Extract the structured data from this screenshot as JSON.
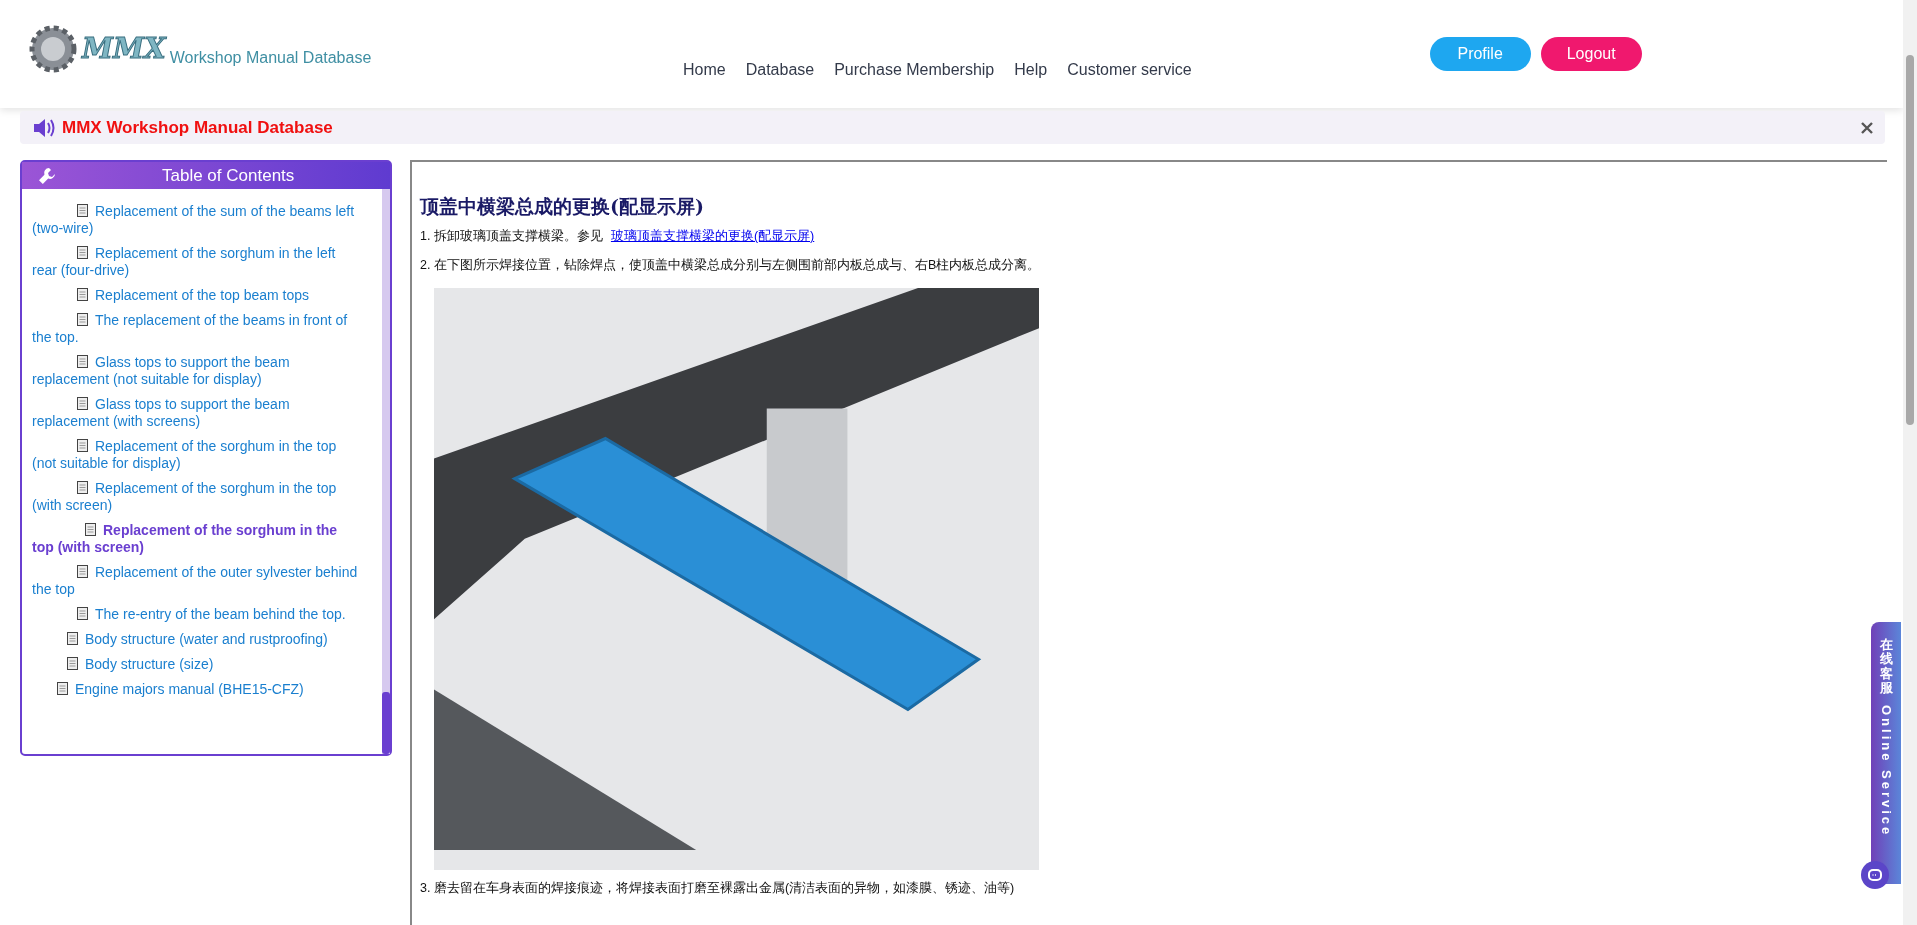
{
  "logo": {
    "mark": "MMX",
    "name": "Workshop Manual Database"
  },
  "nav": [
    "Home",
    "Database",
    "Purchase Membership",
    "Help",
    "Customer service"
  ],
  "account_buttons": [
    {
      "label": "Profile",
      "kind": "primary"
    },
    {
      "label": "Logout",
      "kind": "danger"
    }
  ],
  "notice": {
    "text": "MMX Workshop Manual Database"
  },
  "toc": {
    "title": "Table of Contents",
    "items": [
      {
        "children": [
          {
            "children": [
              {
                "label": "Replacement of the sum of the beams left (two-wire)",
                "selected": false
              },
              {
                "label": "Replacement of the sorghum in the left rear (four-drive)",
                "selected": false
              },
              {
                "label": "Replacement of the top beam tops",
                "selected": false
              },
              {
                "label": "The replacement of the beams in front of the top.",
                "selected": false
              },
              {
                "label": "Glass tops to support the beam replacement (not suitable for display)",
                "selected": false
              },
              {
                "label": "Glass tops to support the beam replacement (with screens)",
                "selected": false
              },
              {
                "label": "Replacement of the sorghum in the top (not suitable for display)",
                "selected": false
              },
              {
                "label": "Replacement of the sorghum in the top (with screen)",
                "selected": false
              },
              {
                "label": "Replacement of the sorghum in the top (with screen)",
                "selected": true
              },
              {
                "label": "Replacement of the outer sylvester behind the top",
                "selected": false
              },
              {
                "label": "The re-entry of the beam behind the top.",
                "selected": false
              }
            ]
          },
          {
            "label": "Body structure (water and rustproofing)",
            "selected": false
          },
          {
            "label": "Body structure (size)",
            "selected": false
          }
        ]
      },
      {
        "label": "Engine majors manual (BHE15-CFZ)",
        "selected": false
      }
    ]
  },
  "document": {
    "title": "顶盖中横梁总成的更换(配显示屏)",
    "steps": [
      {
        "text": "1. 拆卸玻璃顶盖支撑横梁。参见",
        "link": "玻璃顶盖支撑横梁的更换(配显示屏)"
      },
      {
        "text": "2. 在下图所示焊接位置，钻除焊点，使顶盖中横梁总成分别与左侧围前部内板总成与、右B柱内板总成分离。"
      },
      {
        "kind": "figure"
      },
      {
        "text": "3. 磨去留在车身表面的焊接痕迹，将焊接表面打磨至裸露出金属(清洁表面的异物，如漆膜、锈迹、油等)"
      }
    ]
  },
  "online_service": {
    "chinese": "在线客服",
    "english": "Online Service"
  }
}
